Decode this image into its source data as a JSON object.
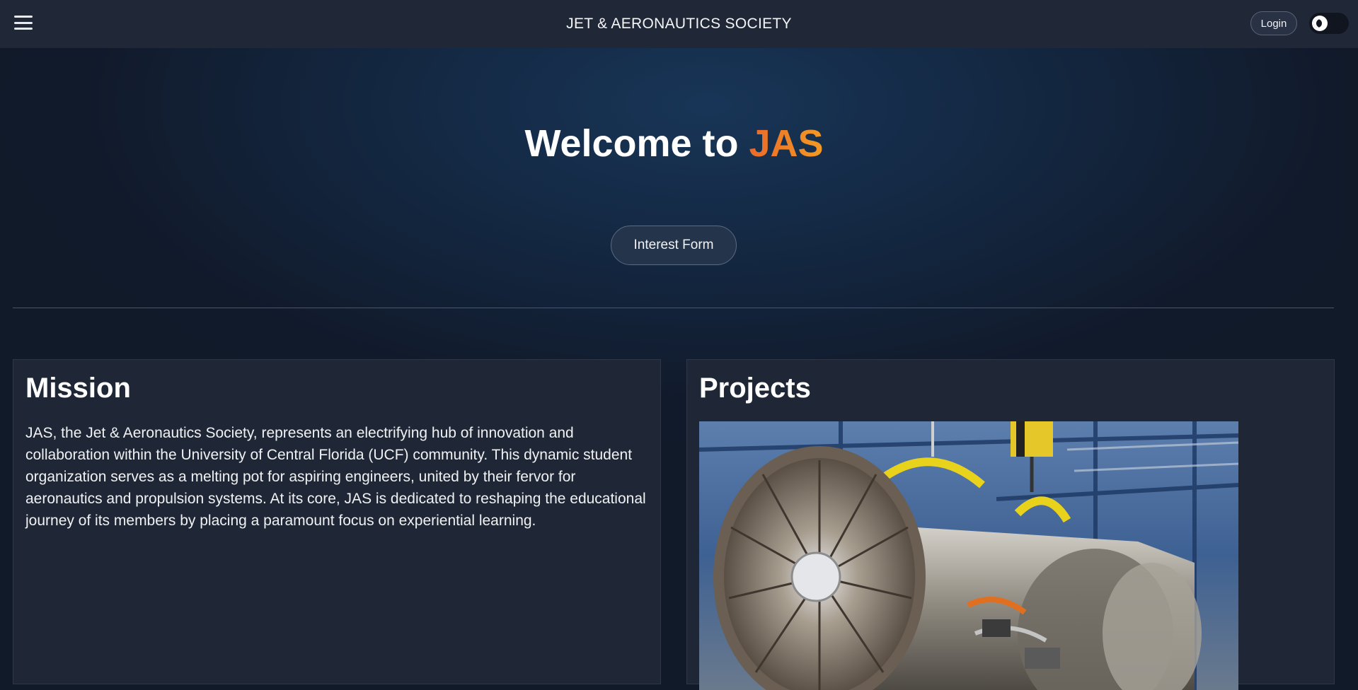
{
  "header": {
    "title": "JET & AERONAUTICS SOCIETY",
    "menu_icon": "hamburger-menu-icon",
    "login_label": "Login",
    "theme_toggle_icon": "moon-icon"
  },
  "hero": {
    "welcome_prefix": "Welcome to ",
    "welcome_accent": "JAS",
    "interest_button": "Interest Form"
  },
  "mission": {
    "heading": "Mission",
    "body": "JAS, the Jet & Aeronautics Society, represents an electrifying hub of innovation and collaboration within the University of Central Florida (UCF) community. This dynamic student organization serves as a melting pot for aspiring engineers, united by their fervor for aeronautics and propulsion systems. At its core, JAS is dedicated to reshaping the educational journey of its members by placing a paramount focus on experiential learning."
  },
  "projects": {
    "heading": "Projects",
    "image_subject": "jet-engine-photo"
  },
  "colors": {
    "background": "#111a28",
    "topbar": "#202838",
    "card": "#1f2736",
    "accent_start": "#ea6a2a",
    "accent_end": "#f39a25"
  }
}
